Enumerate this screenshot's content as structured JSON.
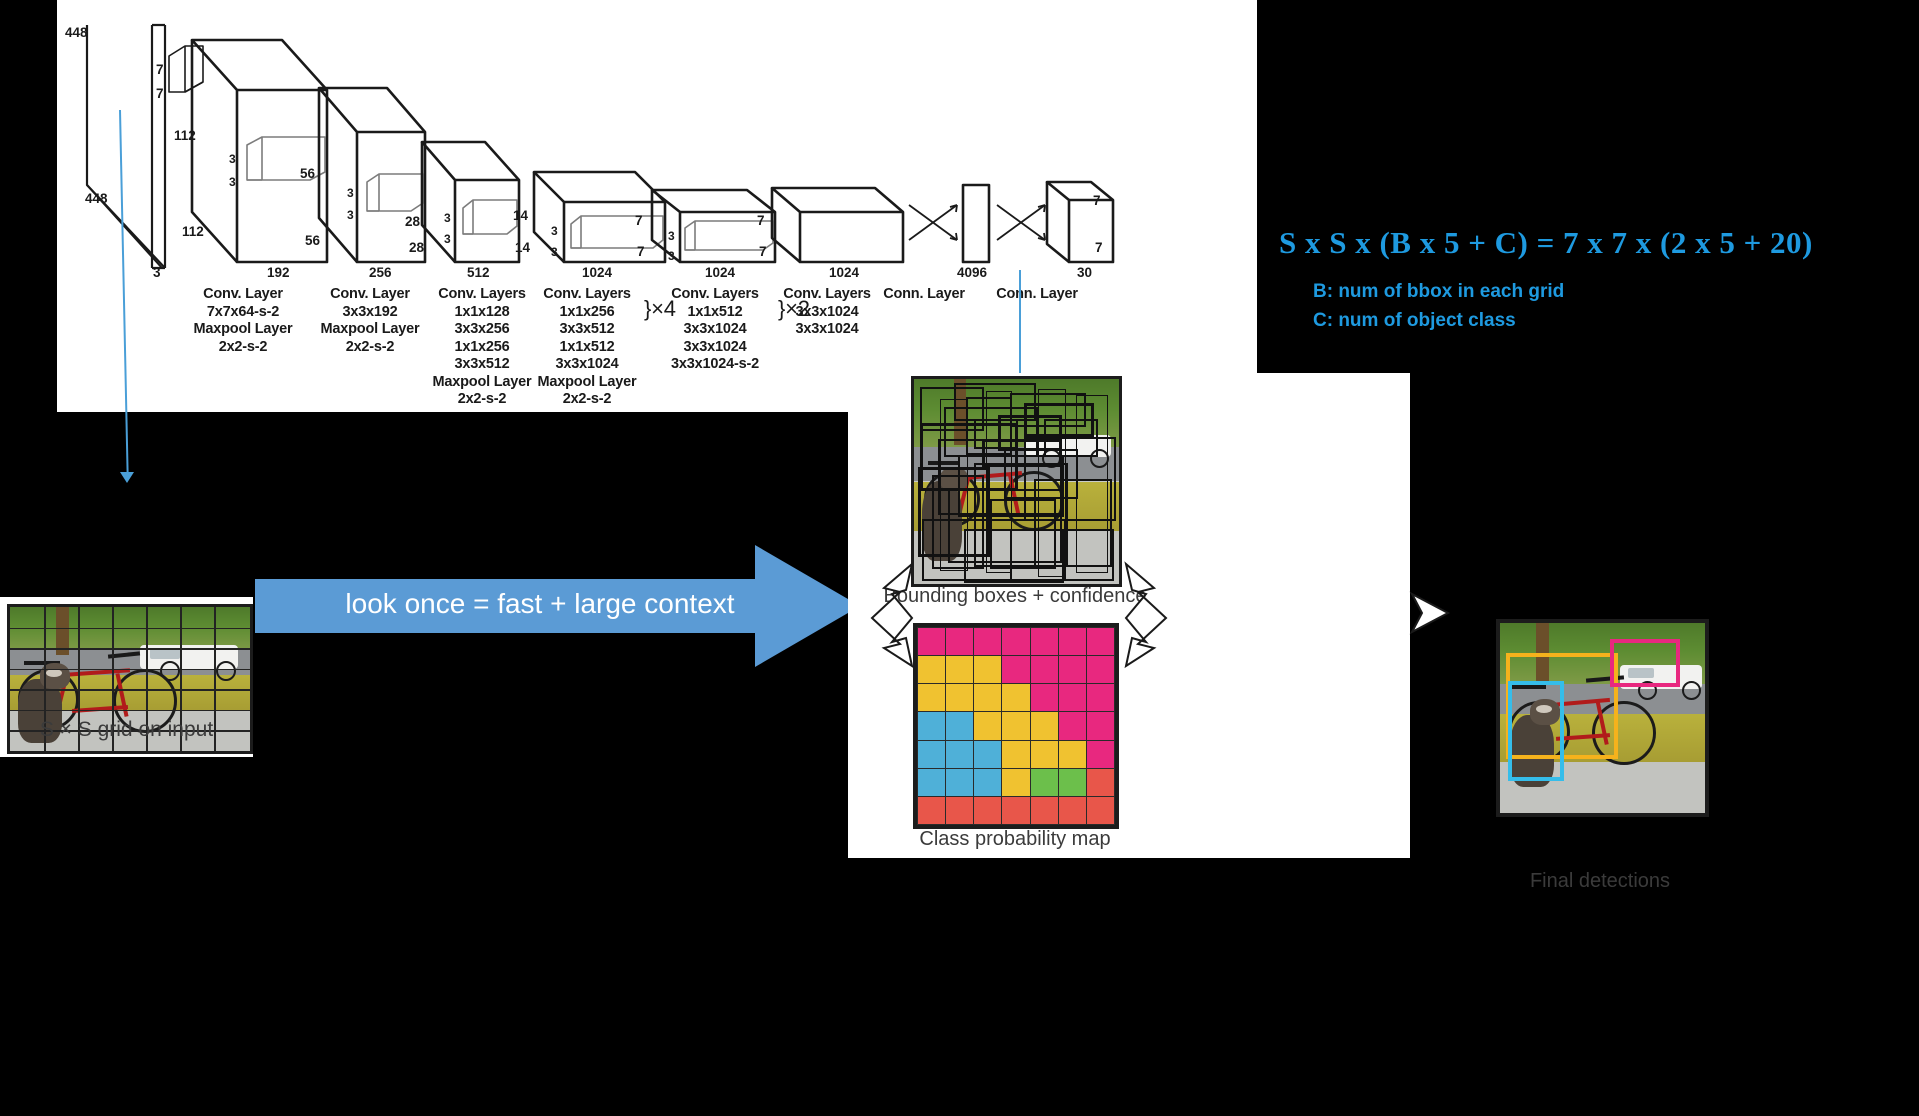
{
  "formula": {
    "text": "S x S x (B x 5 + C) = 7 x 7 x (2 x 5 + 20)",
    "legend_b": "B: num of bbox in each grid",
    "legend_c": "C: num of object class",
    "accent_color": "#1e9ae0"
  },
  "banner": {
    "label": "look once = fast + large context",
    "color": "#5b9bd5"
  },
  "network": {
    "input_dims": {
      "height": "448",
      "width": "448",
      "depth": "3"
    },
    "kernel_first": {
      "h": "7",
      "w": "7"
    },
    "blocks": [
      {
        "name": "block-112",
        "side_top": "112",
        "side_bottom": "112",
        "depth": "192",
        "kh": "3",
        "kw": "3"
      },
      {
        "name": "block-56",
        "side_top": "56",
        "side_bottom": "56",
        "depth": "256",
        "kh": "3",
        "kw": "3"
      },
      {
        "name": "block-28",
        "side_top": "28",
        "side_bottom": "28",
        "depth": "512",
        "kh": "3",
        "kw": "3"
      },
      {
        "name": "block-14",
        "side_top": "14",
        "side_bottom": "14",
        "depth": "1024",
        "kh": "3",
        "kw": "3"
      },
      {
        "name": "block-7a",
        "side_top": "7",
        "side_bottom": "7",
        "depth": "1024",
        "kh": "3",
        "kw": "3"
      },
      {
        "name": "block-7b",
        "side_top": "7",
        "side_bottom": "7",
        "depth": "1024",
        "kh": "",
        "kw": ""
      },
      {
        "name": "block-fc",
        "side_top": "",
        "side_bottom": "",
        "depth": "4096",
        "kh": "",
        "kw": ""
      },
      {
        "name": "block-out",
        "side_top": "7",
        "side_bottom": "7",
        "depth": "30",
        "kh": "",
        "kw": ""
      }
    ],
    "captions": [
      {
        "title": "Conv. Layer",
        "lines": [
          "7x7x64-s-2",
          "Maxpool Layer",
          "2x2-s-2"
        ]
      },
      {
        "title": "Conv. Layer",
        "lines": [
          "3x3x192",
          "Maxpool Layer",
          "2x2-s-2"
        ]
      },
      {
        "title": "Conv. Layers",
        "lines": [
          "1x1x128",
          "3x3x256",
          "1x1x256",
          "3x3x512",
          "Maxpool Layer",
          "2x2-s-2"
        ]
      },
      {
        "title": "Conv. Layers",
        "lines": [
          "1x1x256",
          "3x3x512",
          "1x1x512",
          "3x3x1024",
          "Maxpool Layer",
          "2x2-s-2"
        ],
        "bracket": "}×4"
      },
      {
        "title": "Conv. Layers",
        "lines": [
          "1x1x512",
          "3x3x1024",
          "3x3x1024",
          "3x3x1024-s-2"
        ],
        "bracket": "}×2"
      },
      {
        "title": "Conv. Layers",
        "lines": [
          "3x3x1024",
          "3x3x1024"
        ]
      },
      {
        "title": "Conn. Layer",
        "lines": []
      },
      {
        "title": "Conn. Layer",
        "lines": []
      }
    ]
  },
  "panels": {
    "grid_caption": "S × S grid on input",
    "bbox_caption": "Bounding boxes + confidence",
    "probmap_caption": "Class probability map",
    "final_caption": "Final detections"
  },
  "chart_data": {
    "type": "heatmap",
    "title": "Class probability map",
    "grid_size": [
      7,
      7
    ],
    "legend": {
      "pink": "#e8287f",
      "yellow": "#f0c230",
      "blue": "#4fb0d8",
      "green": "#6cbf4b",
      "red": "#e8564a"
    },
    "cells": [
      [
        "pink",
        "pink",
        "pink",
        "pink",
        "pink",
        "pink",
        "pink"
      ],
      [
        "yellow",
        "yellow",
        "yellow",
        "pink",
        "pink",
        "pink",
        "pink"
      ],
      [
        "yellow",
        "yellow",
        "yellow",
        "yellow",
        "pink",
        "pink",
        "pink"
      ],
      [
        "blue",
        "blue",
        "yellow",
        "yellow",
        "yellow",
        "pink",
        "pink"
      ],
      [
        "blue",
        "blue",
        "blue",
        "yellow",
        "yellow",
        "yellow",
        "pink"
      ],
      [
        "blue",
        "blue",
        "blue",
        "yellow",
        "green",
        "green",
        "red"
      ],
      [
        "red",
        "red",
        "red",
        "red",
        "red",
        "red",
        "red"
      ]
    ]
  },
  "detections": [
    {
      "label": "bicycle",
      "color": "#f5b21c"
    },
    {
      "label": "dog",
      "color": "#35bdea"
    },
    {
      "label": "car",
      "color": "#e8287f"
    }
  ]
}
